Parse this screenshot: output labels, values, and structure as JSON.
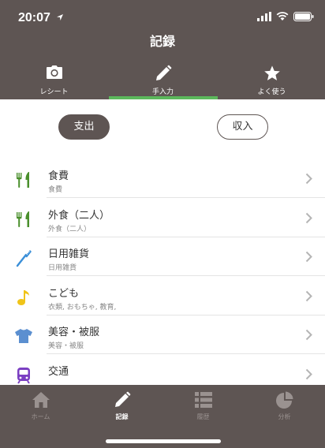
{
  "status_bar": {
    "time": "20:07"
  },
  "header": {
    "title": "記録"
  },
  "top_tabs": [
    {
      "label": "レシート",
      "icon": "camera-icon"
    },
    {
      "label": "手入力",
      "icon": "pencil-icon"
    },
    {
      "label": "よく使う",
      "icon": "star-icon"
    }
  ],
  "toggle": {
    "expense_label": "支出",
    "income_label": "収入"
  },
  "categories": [
    {
      "name": "食費",
      "sub": "食費",
      "icon": "fork-knife-icon",
      "color": "#4a8f2c"
    },
    {
      "name": "外食（二人）",
      "sub": "外食（二人）",
      "icon": "fork-knife-icon",
      "color": "#4a8f2c"
    },
    {
      "name": "日用雑貨",
      "sub": "日用雑貨",
      "icon": "toothbrush-icon",
      "color": "#3b8fd8"
    },
    {
      "name": "こども",
      "sub": "衣類, おもちゃ, 教育,",
      "icon": "music-note-icon",
      "color": "#f0c419"
    },
    {
      "name": "美容・被服",
      "sub": "美容・被服",
      "icon": "tshirt-icon",
      "color": "#5b8fd0"
    },
    {
      "name": "交通",
      "sub": "",
      "icon": "train-icon",
      "color": "#7b3fc2"
    }
  ],
  "bottom_tabs": [
    {
      "label": "ホーム",
      "icon": "home-icon"
    },
    {
      "label": "記録",
      "icon": "pencil-icon"
    },
    {
      "label": "履歴",
      "icon": "list-icon"
    },
    {
      "label": "分析",
      "icon": "pie-chart-icon"
    }
  ],
  "colors": {
    "header": "#5e5553",
    "accent": "#5cb85c"
  }
}
